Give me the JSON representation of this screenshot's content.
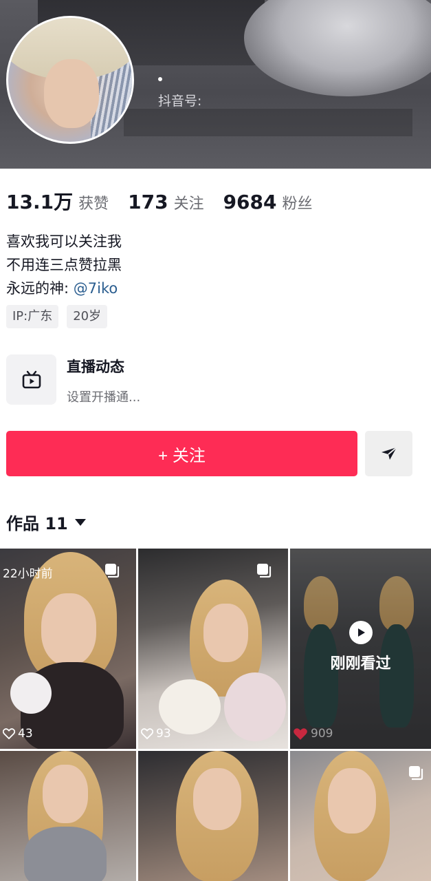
{
  "profile": {
    "douyin_id_label": "抖音号:"
  },
  "stats": [
    {
      "value": "13.1万",
      "label": "获赞"
    },
    {
      "value": "173",
      "label": "关注"
    },
    {
      "value": "9684",
      "label": "粉丝"
    }
  ],
  "bio": {
    "line1": "喜欢我可以关注我",
    "line2": "不用连三点赞拉黑",
    "line3_prefix": "永远的神:",
    "line3_mention": "@7iko"
  },
  "tags": [
    {
      "text": "IP:广东"
    },
    {
      "text": "20岁"
    }
  ],
  "live": {
    "title": "直播动态",
    "subtitle": "设置开播通..."
  },
  "actions": {
    "follow_label": "+ 关注"
  },
  "works": {
    "label": "作品 11"
  },
  "grid": [
    {
      "time": "22小时前",
      "likes": "43"
    },
    {
      "likes": "93"
    },
    {
      "likes": "909",
      "overlay": "刚刚看过"
    }
  ],
  "colors": {
    "accent": "#fe2c55",
    "mention": "#2a5d8f"
  }
}
